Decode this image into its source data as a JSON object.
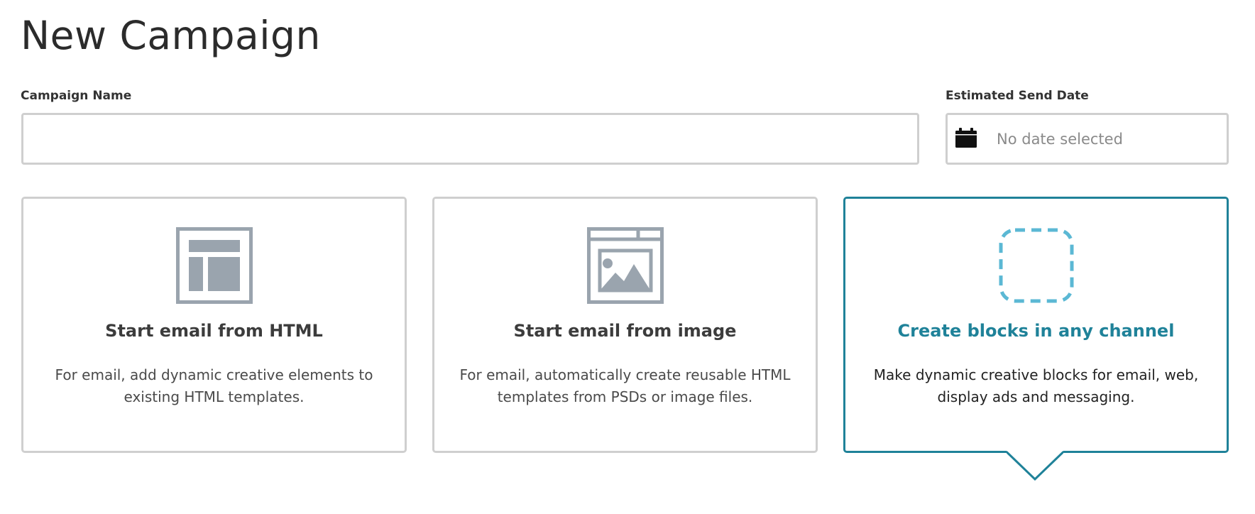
{
  "page": {
    "title": "New Campaign"
  },
  "campaign_name": {
    "label": "Campaign Name",
    "value": "",
    "placeholder": ""
  },
  "send_date": {
    "label": "Estimated Send Date",
    "placeholder": "No date selected",
    "icon": "calendar-icon"
  },
  "cards": [
    {
      "title": "Start email from HTML",
      "description": "For email, add dynamic creative elements to existing HTML templates.",
      "icon": "html-template-icon",
      "selected": false
    },
    {
      "title": "Start email from image",
      "description": "For email, automatically create reusable HTML templates from PSDs or image files.",
      "icon": "image-template-icon",
      "selected": false
    },
    {
      "title": "Create blocks in any channel",
      "description": "Make dynamic creative blocks for email, web, display ads and messaging.",
      "icon": "dashed-block-icon",
      "selected": true
    }
  ],
  "colors": {
    "accent": "#1f8299",
    "border": "#cfcfcf",
    "icon_gray": "#9aa4ae",
    "dashed_blue": "#5bb8d4"
  }
}
